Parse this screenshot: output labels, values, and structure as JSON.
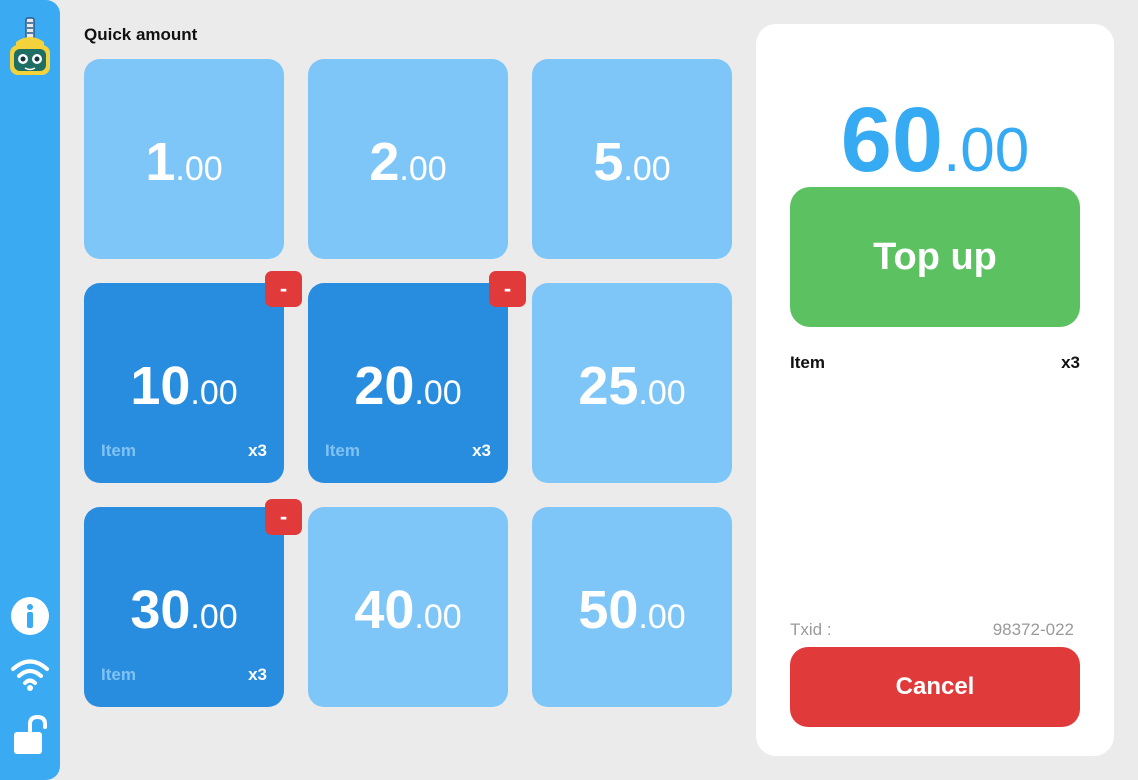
{
  "grid": {
    "title": "Quick amount",
    "tiles": [
      {
        "int": "1",
        "dot": ".",
        "dec": "00",
        "selected": false
      },
      {
        "int": "2",
        "dot": ".",
        "dec": "00",
        "selected": false
      },
      {
        "int": "5",
        "dot": ".",
        "dec": "00",
        "selected": false
      },
      {
        "int": "10",
        "dot": ".",
        "dec": "00",
        "selected": true,
        "item_label": "Item",
        "item_qty": "x3",
        "minus": "-"
      },
      {
        "int": "20",
        "dot": ".",
        "dec": "00",
        "selected": true,
        "item_label": "Item",
        "item_qty": "x3",
        "minus": "-"
      },
      {
        "int": "25",
        "dot": ".",
        "dec": "00",
        "selected": false
      },
      {
        "int": "30",
        "dot": ".",
        "dec": "00",
        "selected": true,
        "item_label": "Item",
        "item_qty": "x3",
        "minus": "-"
      },
      {
        "int": "40",
        "dot": ".",
        "dec": "00",
        "selected": false
      },
      {
        "int": "50",
        "dot": ".",
        "dec": "00",
        "selected": false
      }
    ]
  },
  "panel": {
    "total": {
      "int": "60",
      "dot": ".",
      "dec": "00"
    },
    "topup_label": "Top up",
    "line_item": {
      "label": "Item",
      "qty": "x3"
    },
    "txid_label": "Txid :",
    "txid_value": "98372-022",
    "cancel_label": "Cancel"
  },
  "sidebar": {
    "icons": [
      "robot-logo-icon",
      "info-icon",
      "wifi-icon",
      "unlock-icon"
    ]
  },
  "colors": {
    "sidebar": "#3aaaf2",
    "tile": "#7fc6f8",
    "tile_selected": "#288dde",
    "accent": "#36aaf2",
    "topup": "#5cc160",
    "danger": "#e03a3a",
    "background": "#ebebeb"
  }
}
